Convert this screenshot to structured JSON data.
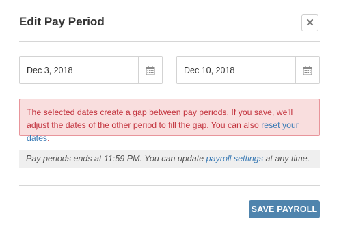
{
  "dialog": {
    "title": "Edit Pay Period",
    "close_icon": "close-icon"
  },
  "dates": {
    "start": "Dec 3, 2018",
    "end": "Dec 10, 2018",
    "calendar_icon": "calendar-icon"
  },
  "alert": {
    "message": "The selected dates create a gap between pay periods. If you save, we'll adjust the dates of the other period to fill the gap. You can also",
    "link": "reset your dates",
    "suffix": ".",
    "color": "#c2313c",
    "background": "#f9dede"
  },
  "note": {
    "prefix": "Pay periods ends at 11:59 PM. You can update",
    "link": "payroll settings",
    "suffix": "at any time."
  },
  "actions": {
    "save_label": "SAVE PAYROLL",
    "save_color": "#4f84ad"
  }
}
